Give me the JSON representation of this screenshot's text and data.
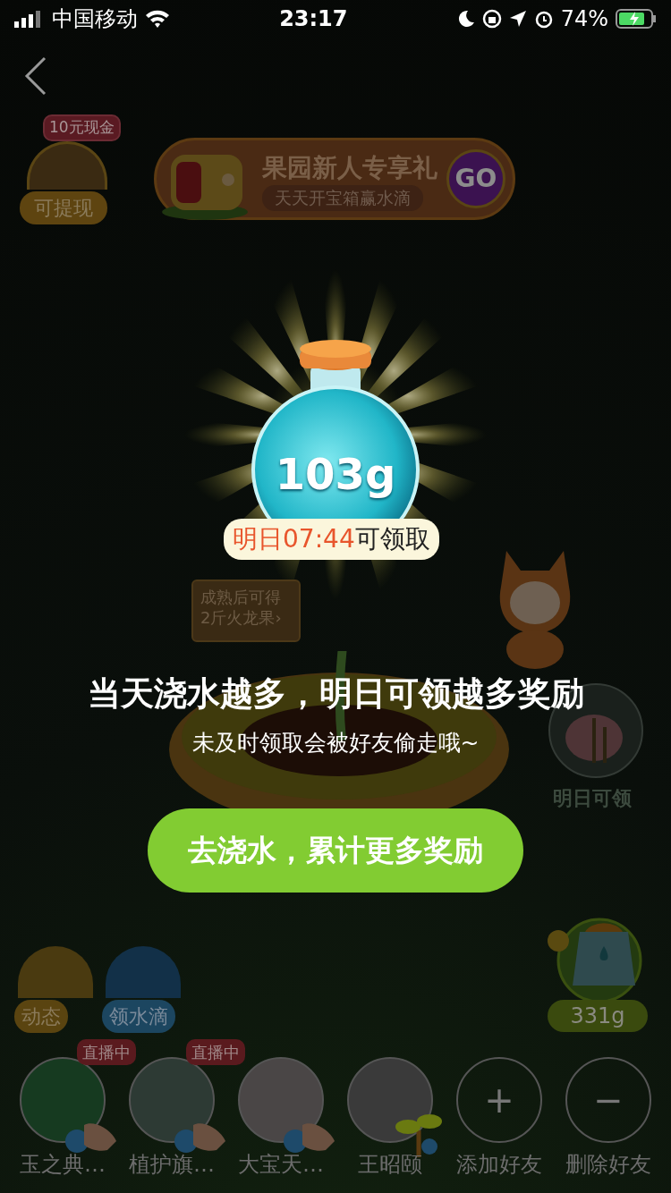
{
  "status_bar": {
    "carrier": "中国移动",
    "time": "23:17",
    "battery": "74%"
  },
  "withdraw": {
    "badge": "10元现金",
    "label": "可提现"
  },
  "promo_banner": {
    "title": "果园新人专享礼",
    "subtitle": "天天开宝箱赢水滴",
    "button": "GO"
  },
  "scene": {
    "sign_lines": [
      "成熟后可得",
      "2斤火龙果›"
    ],
    "tomorrow_label": "明日可领"
  },
  "side_buttons": [
    {
      "kind": "feed",
      "label": "动态"
    },
    {
      "kind": "drops",
      "label": "领水滴"
    }
  ],
  "kettle": {
    "amount": "331g"
  },
  "friends": [
    {
      "kind": "avatar",
      "name": "玉之典…",
      "badge": "直播中",
      "can_water": true
    },
    {
      "kind": "avatar",
      "name": "植护旗…",
      "badge": "直播中",
      "can_water": true
    },
    {
      "kind": "avatar",
      "name": "大宝天…",
      "can_water": true
    },
    {
      "kind": "avatar",
      "name": "王昭颐",
      "can_water": false
    },
    {
      "kind": "add",
      "name": "添加好友",
      "symbol": "+"
    },
    {
      "kind": "remove",
      "name": "删除好友",
      "symbol": "−"
    }
  ],
  "reward_popup": {
    "amount": "103g",
    "claim_time": "明日07:44",
    "claim_suffix": "可领取",
    "headline": "当天浇水越多，明日可领越多奖励",
    "subline": "未及时领取会被好友偷走哦~",
    "button": "去浇水，累计更多奖励"
  }
}
